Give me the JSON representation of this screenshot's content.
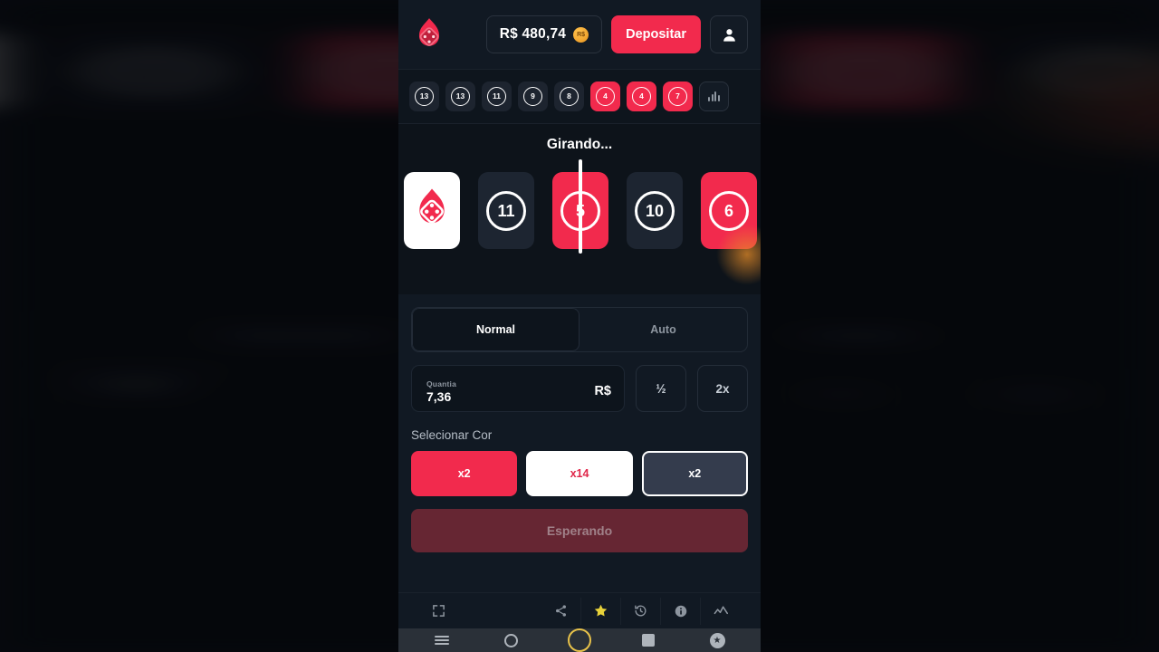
{
  "app": {
    "logo_icon": "flame-dice-logo-icon"
  },
  "header": {
    "balance": "R$ 480,74",
    "coin_label": "R$",
    "coin_icon": "coin-icon",
    "deposit_label": "Depositar",
    "avatar_icon": "user-avatar-icon"
  },
  "history": {
    "items": [
      {
        "value": "13",
        "color": "dark"
      },
      {
        "value": "13",
        "color": "dark"
      },
      {
        "value": "11",
        "color": "dark"
      },
      {
        "value": "9",
        "color": "dark"
      },
      {
        "value": "8",
        "color": "dark"
      },
      {
        "value": "4",
        "color": "red"
      },
      {
        "value": "4",
        "color": "red"
      },
      {
        "value": "7",
        "color": "red"
      }
    ],
    "stats_icon": "bar-chart-icon"
  },
  "spin": {
    "status": "Girando...",
    "tiles": [
      {
        "value": "",
        "color": "white",
        "icon": "flame-dice-logo-icon"
      },
      {
        "value": "11",
        "color": "dark",
        "icon": ""
      },
      {
        "value": "5",
        "color": "red",
        "icon": ""
      },
      {
        "value": "10",
        "color": "dark",
        "icon": ""
      },
      {
        "value": "6",
        "color": "red",
        "icon": ""
      }
    ]
  },
  "modes": {
    "normal_label": "Normal",
    "auto_label": "Auto",
    "selected": "Normal"
  },
  "amount": {
    "label": "Quantia",
    "value": "7,36",
    "currency": "R$",
    "half_label": "½",
    "double_label": "2x"
  },
  "color_select": {
    "title": "Selecionar Cor",
    "options": [
      {
        "label": "x2",
        "variant": "red",
        "selected": false
      },
      {
        "label": "x14",
        "variant": "white",
        "selected": false
      },
      {
        "label": "x2",
        "variant": "dark",
        "selected": true
      }
    ]
  },
  "action": {
    "label": "Esperando"
  },
  "toolbar": {
    "fullscreen_icon": "fullscreen-icon",
    "items": [
      {
        "icon": "share-icon"
      },
      {
        "icon": "star-icon"
      },
      {
        "icon": "history-icon"
      },
      {
        "icon": "info-icon"
      },
      {
        "icon": "chart-icon"
      }
    ]
  },
  "navbar": {
    "items": [
      {
        "icon": "menu-icon"
      },
      {
        "icon": "search-circle-icon"
      },
      {
        "icon": "home-circle-icon"
      },
      {
        "icon": "stop-square-icon"
      },
      {
        "icon": "star-badge-icon"
      }
    ]
  },
  "colors": {
    "accent_red": "#f22a4d",
    "panel_bg": "#111923",
    "page_bg": "#0e151d",
    "tile_dark": "#1d2531",
    "star_yellow": "#e8d23a"
  }
}
